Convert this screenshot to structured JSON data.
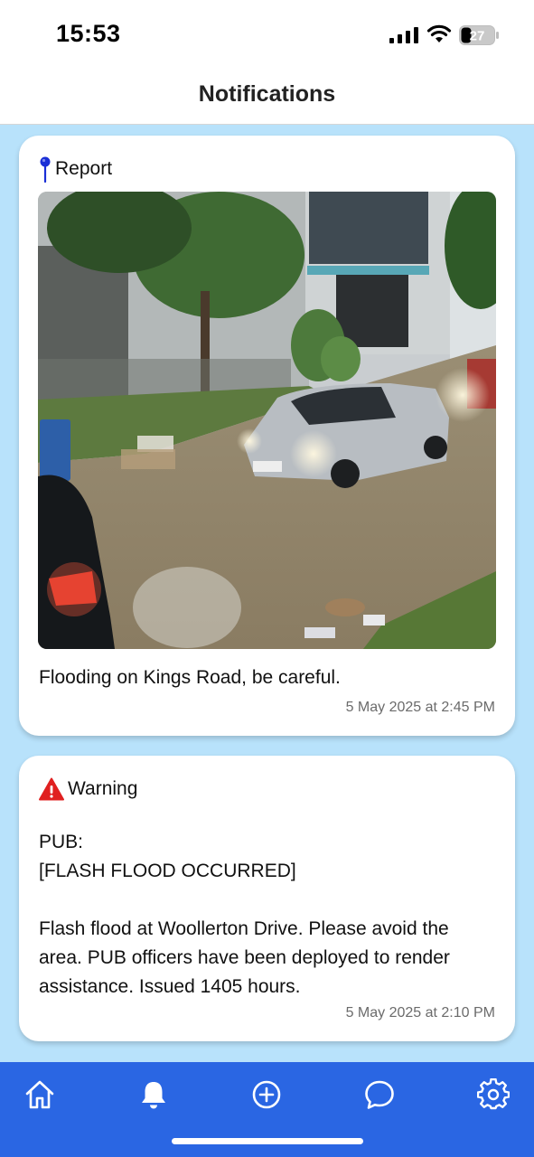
{
  "status_bar": {
    "time": "15:53",
    "battery_level": "27"
  },
  "header": {
    "title": "Notifications"
  },
  "notifications": [
    {
      "type_label": "Report",
      "icon": "pin-icon",
      "text": "Flooding on Kings Road, be careful.",
      "timestamp": "5 May 2025 at 2:45 PM"
    },
    {
      "type_label": "Warning",
      "icon": "warning-icon",
      "text": "PUB:\n[FLASH FLOOD OCCURRED]\n\nFlash flood at Woollerton Drive. Please avoid the area. PUB officers have been deployed to render assistance. Issued 1405 hours.",
      "timestamp": "5 May 2025 at 2:10 PM"
    }
  ],
  "tab_bar": {
    "items": [
      "home-icon",
      "bell-icon",
      "plus-circle-icon",
      "chat-bubble-icon",
      "gear-icon"
    ],
    "active": "bell-icon"
  },
  "colors": {
    "content_background": "#b8e2fb",
    "tab_bar": "#2a66e3",
    "warning_red": "#e02020",
    "pin_blue": "#1a2fd6"
  }
}
